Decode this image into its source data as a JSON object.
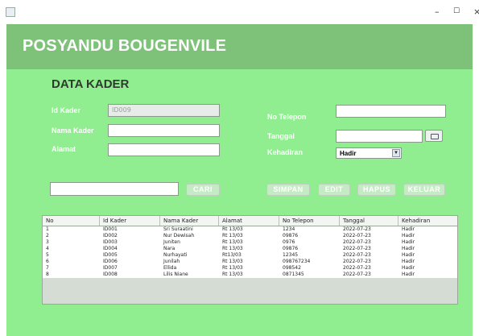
{
  "window": {
    "minimize": "–",
    "maximize": "☐",
    "close": "×"
  },
  "app_title": "POSYANDU BOUGENVILE",
  "section_title": "DATA KADER",
  "form": {
    "id_kader_label": "Id Kader",
    "id_kader_value": "ID009",
    "nama_kader_label": "Nama Kader",
    "nama_kader_value": "",
    "alamat_label": "Alamat",
    "alamat_value": "",
    "no_telepon_label": "No Telepon",
    "no_telepon_value": "",
    "tanggal_label": "Tanggal",
    "tanggal_value": "",
    "kehadiran_label": "Kehadiran",
    "kehadiran_value": "Hadir"
  },
  "search": {
    "value": "",
    "button": "CARI"
  },
  "actions": {
    "simpan": "SIMPAN",
    "edit": "EDIT",
    "hapus": "HAPUS",
    "keluar": "KELUAR"
  },
  "table": {
    "headers": [
      "No",
      "Id Kader",
      "Nama Kader",
      "Alamat",
      "No Telepon",
      "Tanggal",
      "Kehadiran"
    ],
    "rows": [
      [
        "1",
        "ID001",
        "Sri Suraatini",
        "Rt 13/03",
        "1234",
        "2022-07-23",
        "Hadir"
      ],
      [
        "2",
        "ID002",
        "Nur Dewisah",
        "Rt 13/03",
        "09876",
        "2022-07-23",
        "Hadir"
      ],
      [
        "3",
        "ID003",
        "Juniten",
        "Rt 13/03",
        "0976",
        "2022-07-23",
        "Hadir"
      ],
      [
        "4",
        "ID004",
        "Nara",
        "Rt 13/03",
        "09876",
        "2022-07-23",
        "Hadir"
      ],
      [
        "5",
        "ID005",
        "Nurhayati",
        "Rt13/03",
        "12345",
        "2022-07-23",
        "Hadir"
      ],
      [
        "6",
        "ID006",
        "Junilah",
        "Rt 13/03",
        "098767234",
        "2022-07-23",
        "Hadir"
      ],
      [
        "7",
        "ID007",
        "Ellida",
        "Rt 13/03",
        "098542",
        "2022-07-23",
        "Hadir"
      ],
      [
        "8",
        "ID008",
        "Lilis Niane",
        "Rt 13/03",
        "0871345",
        "2022-07-23",
        "Hadir"
      ]
    ]
  },
  "colors": {
    "background": "#90ee90",
    "banner": "#7ec27a",
    "title_text": "#ffffff"
  }
}
